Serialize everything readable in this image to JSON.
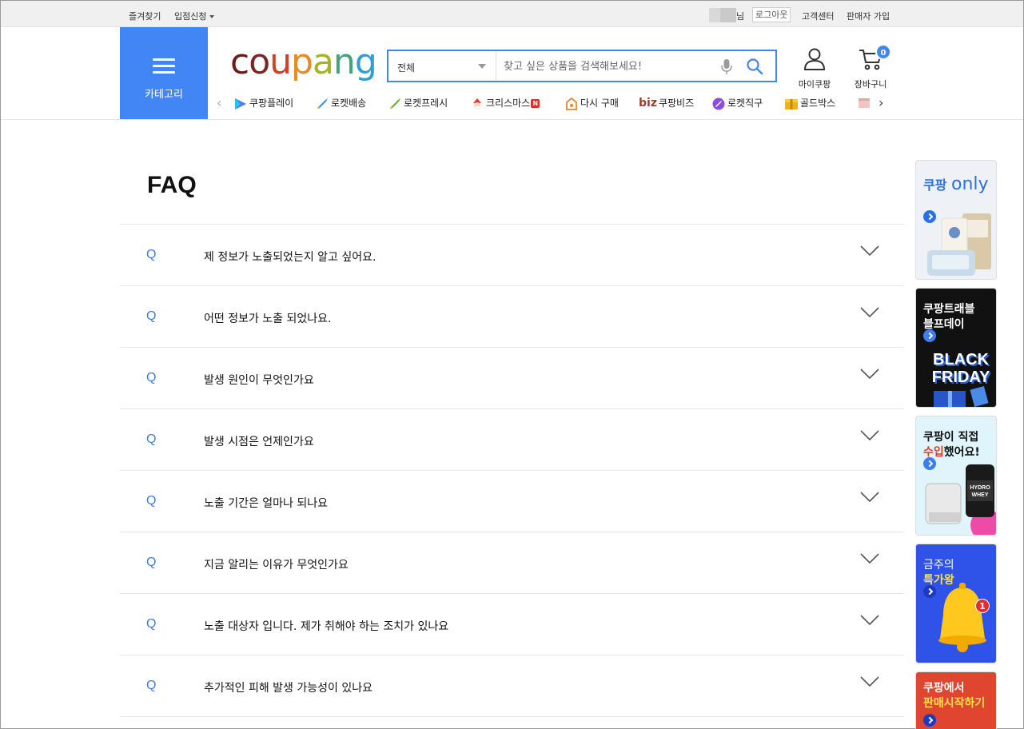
{
  "topbar": {
    "bookmark": "즐겨찾기",
    "seller_apply": "입점신청",
    "user_suffix": "님",
    "logout": "로그아웃",
    "customer_center": "고객센터",
    "seller_signup": "판매자 가입"
  },
  "header": {
    "category_label": "카테고리",
    "logo_letters": [
      "c",
      "o",
      "u",
      "p",
      "a",
      "n",
      "g"
    ],
    "search": {
      "scope": "전체",
      "placeholder": "찾고 싶은 상품을 검색해보세요!"
    },
    "my_coupang": "마이쿠팡",
    "cart_label": "장바구니",
    "cart_count": "0"
  },
  "nav": {
    "items": [
      {
        "label": "쿠팡플레이",
        "icon": "play-icon"
      },
      {
        "label": "로켓배송",
        "icon": "rocket-icon"
      },
      {
        "label": "로켓프레시",
        "icon": "rocket-fresh-icon"
      },
      {
        "label": "크리스마스",
        "icon": "santa-icon",
        "badge": "N"
      },
      {
        "label": "다시 구매",
        "icon": "rebuy-icon"
      },
      {
        "label": "쿠팡비즈",
        "prefix": "biz"
      },
      {
        "label": "로켓직구",
        "icon": "global-rocket-icon"
      },
      {
        "label": "골드박스",
        "icon": "goldbox-icon"
      }
    ]
  },
  "faq": {
    "title": "FAQ",
    "q_mark": "Q",
    "items": [
      "제 정보가 노출되었는지 알고 싶어요.",
      "어떤 정보가 노출 되었나요.",
      "발생 원인이 무엇인가요",
      "발생 시점은 언제인가요",
      "노출 기간은 얼마나 되나요",
      "지금 알리는 이유가 무엇인가요",
      "노출 대상자 입니다. 제가 취해야 하는 조치가 있나요",
      "추가적인 피해 발생 가능성이 있나요"
    ]
  },
  "banners": [
    {
      "line1": "쿠팡",
      "line2": "only",
      "bg": "#eef2f7",
      "color": "#2b6fe8"
    },
    {
      "line1": "쿠팡트래블",
      "line2": "블프데이",
      "art": "BLACK FRIDAY",
      "bg": "#111111",
      "color": "#ffffff"
    },
    {
      "line1": "쿠팡이 직접",
      "line2_a": "수입",
      "line2_b": "했어요!",
      "art": "HYDRO WHEY",
      "bg": "#dff4fb",
      "color": "#111111"
    },
    {
      "line1": "금주의",
      "line2": "특가왕",
      "badge": "1",
      "bg": "#2f52e8",
      "color": "#ffffff"
    },
    {
      "line1": "쿠팡에서",
      "line2": "판매시작하기",
      "bg": "#e0452f",
      "color": "#ffffff"
    }
  ],
  "colors": {
    "brand_blue": "#4285f4",
    "q_blue": "#3b7ddd"
  }
}
